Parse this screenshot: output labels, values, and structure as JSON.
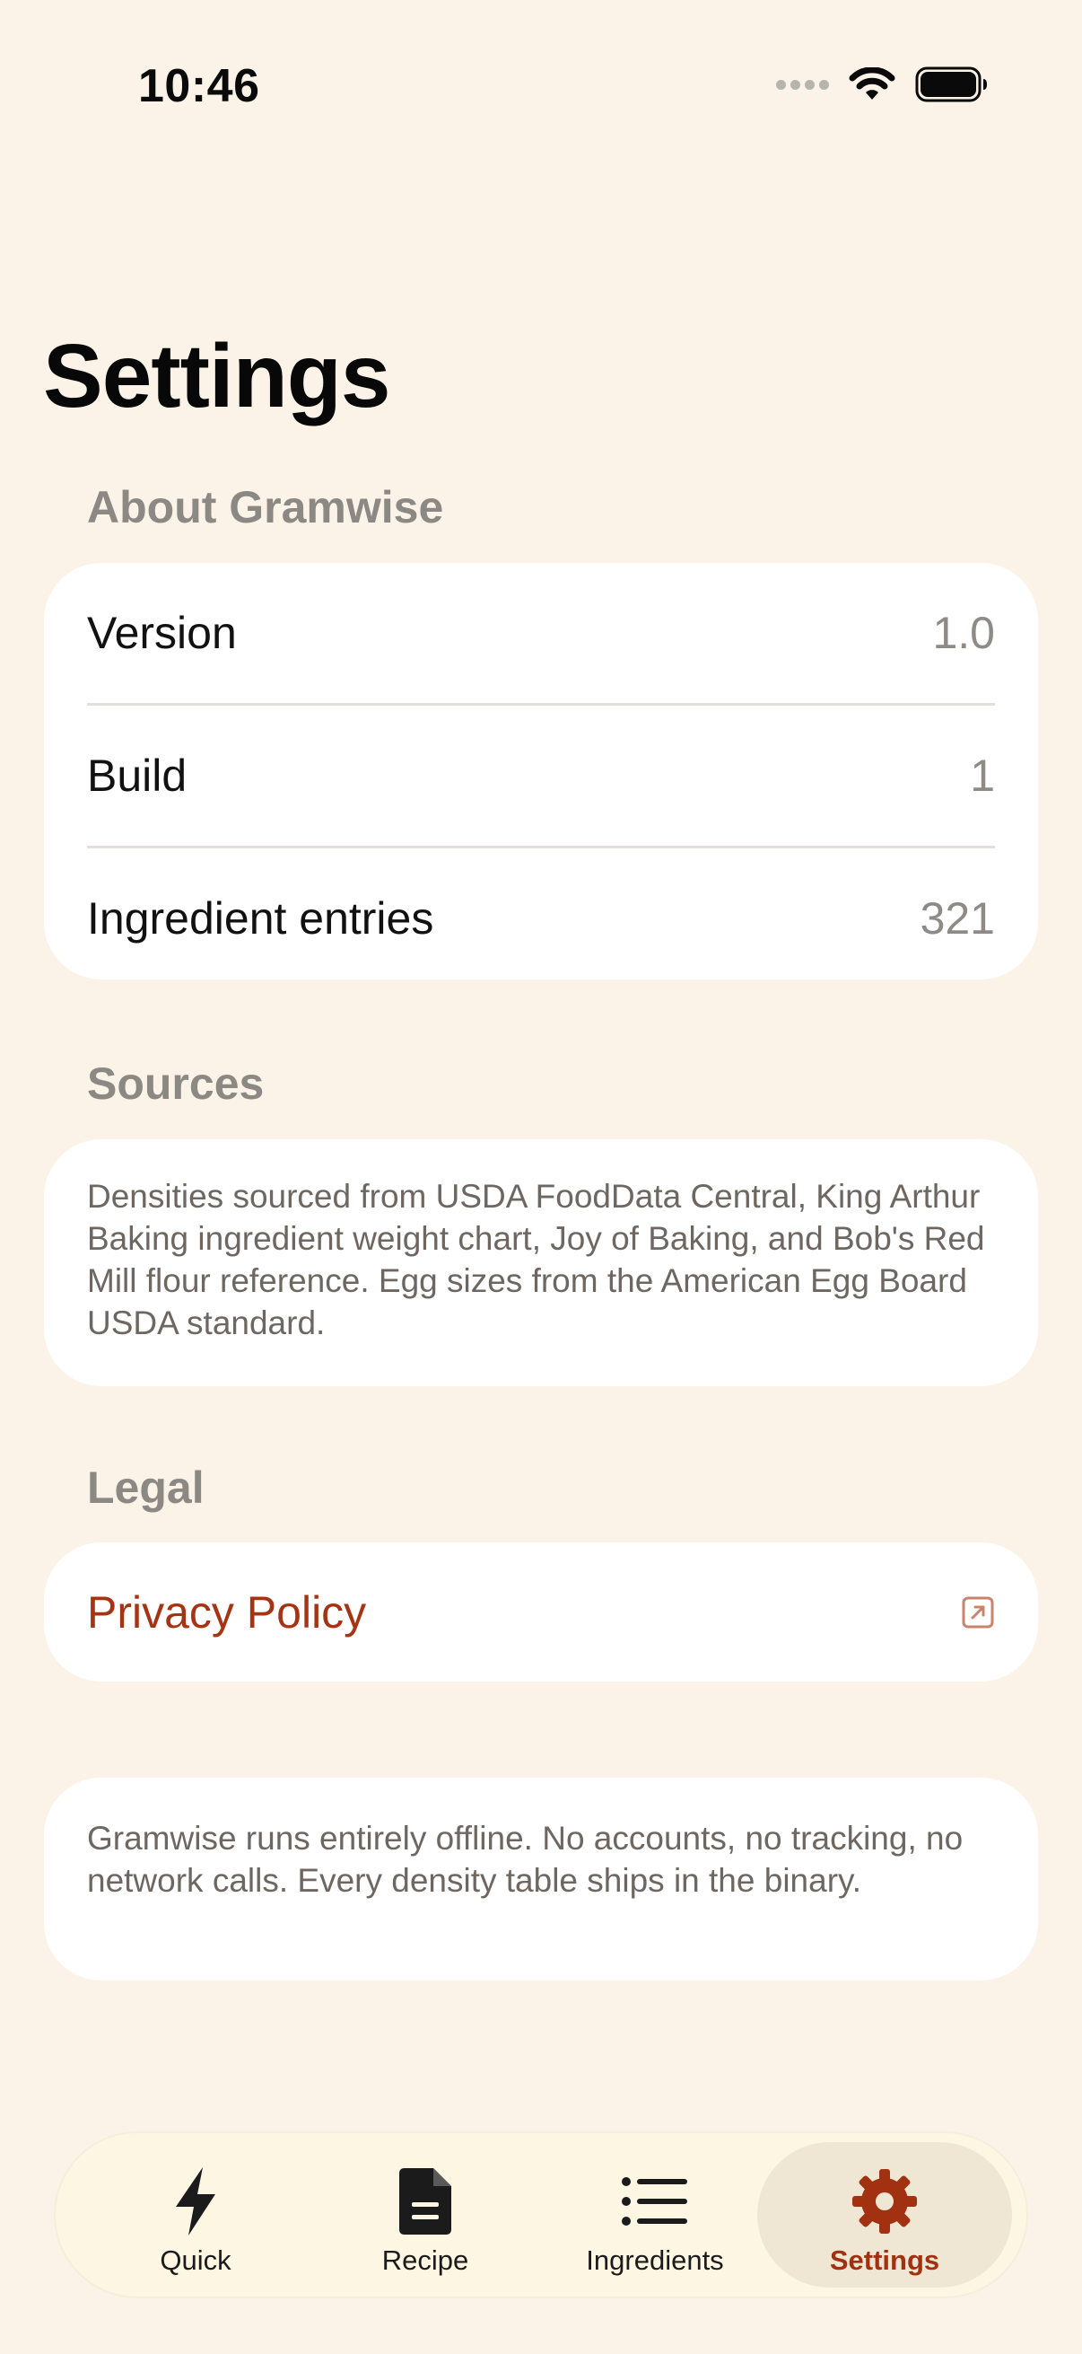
{
  "status_bar": {
    "time": "10:46"
  },
  "page_title": "Settings",
  "sections": {
    "about": {
      "header": "About Gramwise",
      "rows": [
        {
          "label": "Version",
          "value": "1.0"
        },
        {
          "label": "Build",
          "value": "1"
        },
        {
          "label": "Ingredient entries",
          "value": "321"
        }
      ]
    },
    "sources": {
      "header": "Sources",
      "text": "Densities sourced from USDA FoodData Central, King Arthur Baking ingredient weight chart, Joy of Baking, and Bob's Red Mill flour reference. Egg sizes from the American Egg Board USDA standard."
    },
    "legal": {
      "header": "Legal",
      "privacy_label": "Privacy Policy"
    },
    "offline_note": {
      "text": "Gramwise runs entirely offline. No accounts, no tracking, no network calls. Every density table ships in the binary."
    }
  },
  "tab_bar": {
    "tabs": [
      {
        "label": "Quick",
        "icon": "bolt-icon"
      },
      {
        "label": "Recipe",
        "icon": "document-icon"
      },
      {
        "label": "Ingredients",
        "icon": "list-icon"
      },
      {
        "label": "Settings",
        "icon": "gear-icon"
      }
    ],
    "active_tab": "Settings"
  },
  "colors": {
    "background": "#fbf3e7",
    "accent": "#a53414",
    "secondary_text": "#8c8884"
  }
}
